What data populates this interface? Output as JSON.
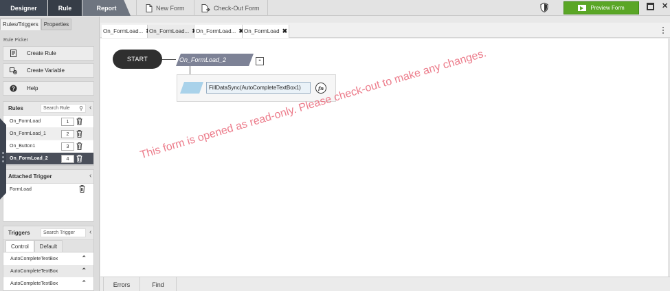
{
  "topbar": {
    "tabs": [
      "Designer",
      "Rule",
      "Report"
    ],
    "new_form": "New Form",
    "check_out_form": "Check-Out Form",
    "preview_form": "Preview Form"
  },
  "left_panel": {
    "tabs": [
      "Rules/Triggers",
      "Properties"
    ],
    "rule_picker_label": "Rule Picker",
    "picker": {
      "create_rule": "Create Rule",
      "create_variable": "Create Variable",
      "help": "Help"
    },
    "rules": {
      "title": "Rules",
      "search_placeholder": "Search Rule",
      "items": [
        {
          "name": "On_FormLoad",
          "order": "1"
        },
        {
          "name": "On_FormLoad_1",
          "order": "2"
        },
        {
          "name": "On_Button1",
          "order": "3"
        },
        {
          "name": "On_FormLoad_2",
          "order": "4",
          "selected": true
        }
      ]
    },
    "attached_trigger": {
      "title": "Attached Trigger",
      "items": [
        "FormLoad"
      ]
    },
    "triggers": {
      "title": "Triggers",
      "search_placeholder": "Search Trigger",
      "tabs": [
        "Control",
        "Default"
      ],
      "items": [
        "AutoCompleteTextBox",
        "AutoCompleteTextBox",
        "AutoCompleteTextBox"
      ]
    }
  },
  "editor": {
    "tabs": [
      {
        "label": "On_FormLoad...",
        "close": "✖"
      },
      {
        "label": "On_FormLoad...",
        "close": "✖"
      },
      {
        "label": "On_FormLoad...",
        "close": "✖"
      },
      {
        "label": "On_FormLoad",
        "close": "✖"
      }
    ],
    "start_label": "START",
    "event_label": "On_FormLoad_2",
    "collapse_label": "-",
    "action_label": "FillDataSync(AutoCompleteTextBox1)",
    "fx_label": "fn",
    "watermark": "This form is opened as read-only. Please check-out to make any changes."
  },
  "bottom_tabs": [
    "Errors",
    "Find"
  ],
  "colors": {
    "accent_green": "#5aa626",
    "dark_tab": "#3e4652",
    "selected_rule": "#4a4f5a",
    "watermark": "#ec7b8a",
    "event_node": "#7d8296",
    "action_param": "#a9d2ea"
  }
}
